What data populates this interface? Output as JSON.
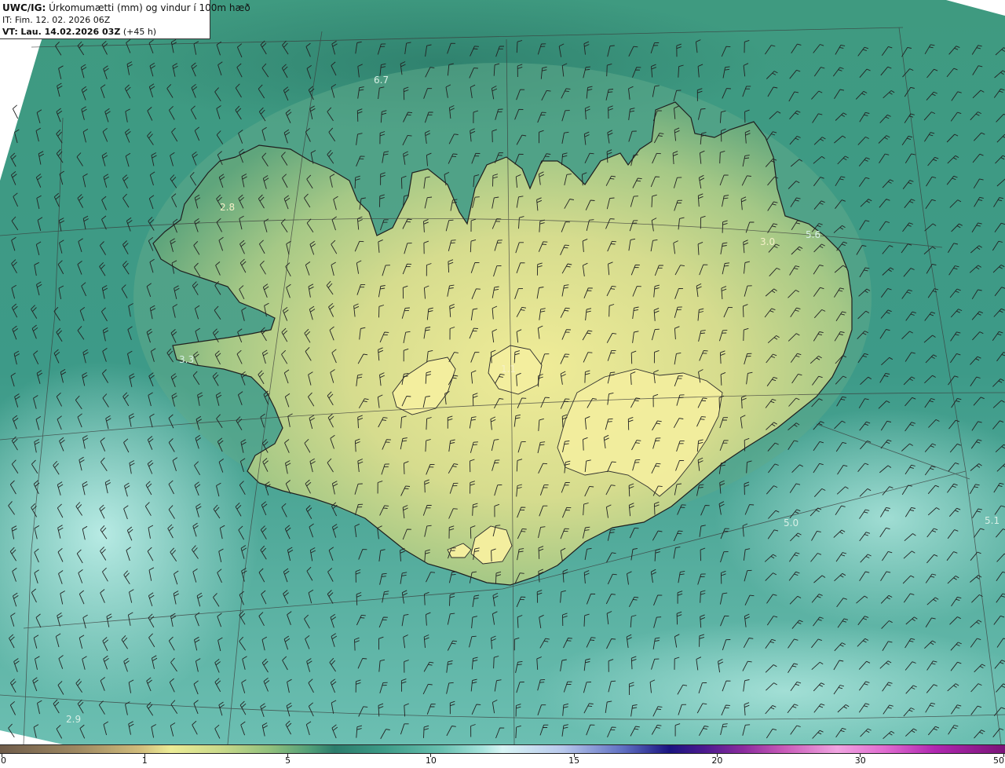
{
  "header": {
    "model": "UWC/IG:",
    "title": "Úrkomumætti (mm) og vindur í 100m hæð",
    "it_label": "IT:",
    "it_value": "Fim. 12. 02. 2026 06Z",
    "vt_label": "VT:",
    "vt_value": "Lau. 14.02.2026 03Z",
    "lead": "(+45 h)"
  },
  "colorbar": {
    "ticks": [
      {
        "label": "0",
        "value": 0
      },
      {
        "label": "1",
        "value": 1
      },
      {
        "label": "5",
        "value": 5
      },
      {
        "label": "10",
        "value": 10
      },
      {
        "label": "15",
        "value": 15
      },
      {
        "label": "20",
        "value": 20
      },
      {
        "label": "30",
        "value": 30
      },
      {
        "label": "50",
        "value": 50
      }
    ]
  },
  "map_labels": [
    {
      "text": "6.7"
    },
    {
      "text": "2.8"
    },
    {
      "text": "3.0"
    },
    {
      "text": "5.6"
    },
    {
      "text": "3.3"
    },
    {
      "text": "1.1"
    },
    {
      "text": "5.0"
    },
    {
      "text": "5.1"
    },
    {
      "text": "2.9"
    }
  ],
  "colors": {
    "land_high": "#ecec96",
    "land_mid": "#a9c987",
    "sea": "#3c9a86",
    "sea_light": "#a6e3dc",
    "coast": "#222222"
  }
}
